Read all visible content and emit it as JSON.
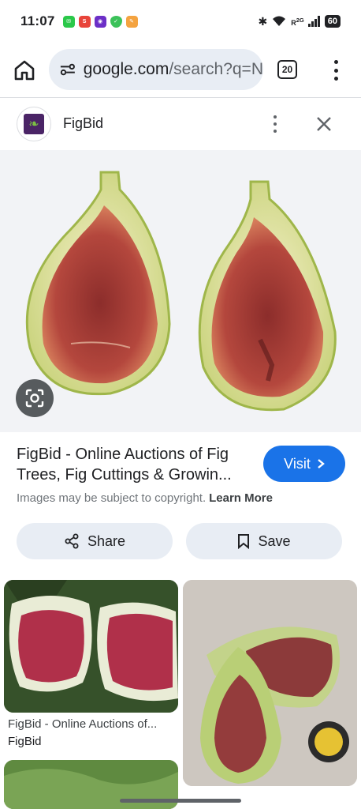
{
  "status_bar": {
    "time": "11:07",
    "network": "R",
    "network_gen": "2G",
    "battery": "60",
    "apps": [
      {
        "name": "messaging-app-icon",
        "color": "#2bc84a"
      },
      {
        "name": "shopping-app-icon",
        "color": "#e8443a",
        "label": "SHEIN"
      },
      {
        "name": "camera-app-icon",
        "color": "#6c2fc7"
      },
      {
        "name": "shield-app-icon",
        "color": "#3cc25a"
      },
      {
        "name": "mail-app-icon",
        "color": "#f4a340"
      }
    ]
  },
  "browser": {
    "url_domain": "google.com",
    "url_path": "/search?q=",
    "url_cut": "N",
    "tab_count": "20"
  },
  "site": {
    "name": "FigBid"
  },
  "result": {
    "title": "FigBid - Online Auctions of Fig Trees, Fig Cuttings & Growin...",
    "visit_label": "Visit",
    "copyright_text": "Images may be subject to copyright.",
    "learn_more": "Learn More",
    "share_label": "Share",
    "save_label": "Save"
  },
  "grid": {
    "items": [
      {
        "title": "FigBid - Online Auctions of...",
        "source": "FigBid"
      }
    ]
  },
  "colors": {
    "accent": "#1a73e8",
    "pill_bg": "#e8edf4",
    "fig_flesh": "#a83a3a",
    "fig_skin": "#d9e29a"
  }
}
